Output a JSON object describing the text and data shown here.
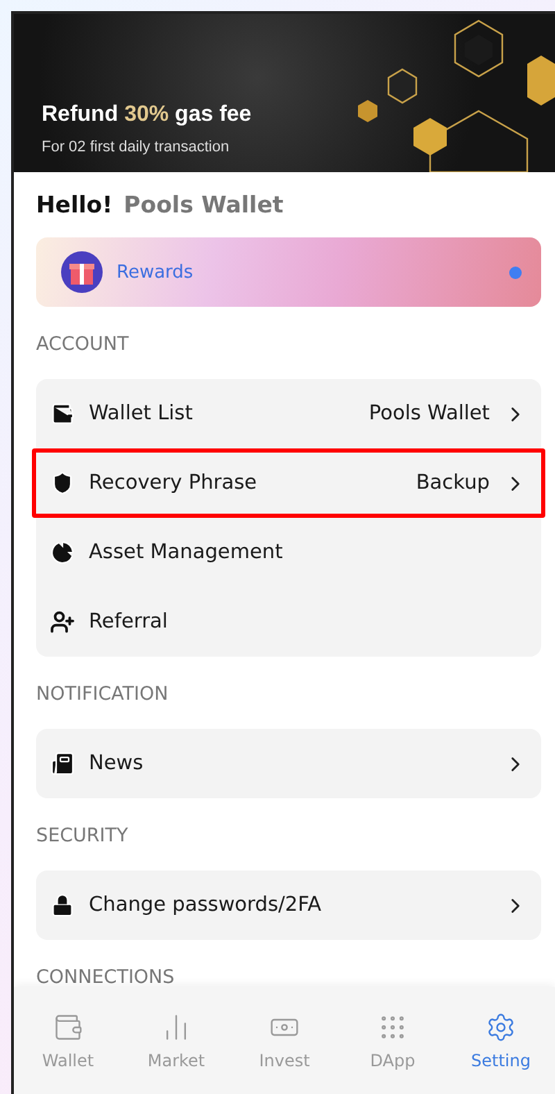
{
  "banner": {
    "title": "Refund",
    "highlight": "30%",
    "title_end": "gas fee",
    "subtitle": "For 02 first daily transaction"
  },
  "greeting": {
    "hello": "Hello!",
    "name": "Pools Wallet"
  },
  "rewards": {
    "label": "Rewards",
    "unread": true
  },
  "sections": [
    {
      "title": "ACCOUNT",
      "items": [
        {
          "label": "Wallet List",
          "value": "Pools Wallet",
          "chevron": true,
          "highlighted": false
        },
        {
          "label": "Recovery Phrase",
          "value": "Backup",
          "chevron": true,
          "highlighted": true
        },
        {
          "label": "Asset Management",
          "chevron": false,
          "highlighted": false
        },
        {
          "label": "Referral",
          "chevron": false,
          "highlighted": false
        }
      ]
    },
    {
      "title": "NOTIFICATION",
      "items": [
        {
          "label": "News",
          "chevron": true,
          "highlighted": false
        }
      ]
    },
    {
      "title": "SECURITY",
      "items": [
        {
          "label": "Change passwords/2FA",
          "chevron": true,
          "highlighted": false
        }
      ]
    },
    {
      "title": "CONNECTIONS"
    }
  ],
  "nav": [
    {
      "label": "Wallet",
      "selected": false
    },
    {
      "label": "Market",
      "selected": false
    },
    {
      "label": "Invest",
      "selected": false
    },
    {
      "label": "DApp",
      "selected": false
    },
    {
      "label": "Setting",
      "selected": true
    }
  ]
}
